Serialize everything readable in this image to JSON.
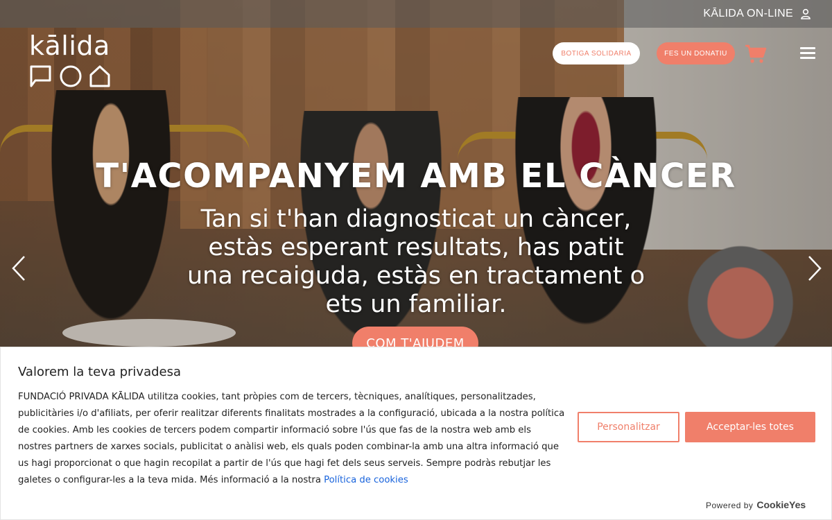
{
  "topbar": {
    "online_label": "KĀLIDA ON-LINE",
    "user_icon": "user-icon"
  },
  "logo": {
    "word": "kālida",
    "shapes": [
      "speech-bubble-icon",
      "circle-icon",
      "house-icon"
    ]
  },
  "header": {
    "shop_label": "BOTIGA SOLIDARIA",
    "donate_label": "FES UN DONATIU",
    "cart_icon": "cart-icon",
    "menu_icon": "hamburger-menu-icon"
  },
  "hero": {
    "title": "T'ACOMPANYEM AMB EL CÀNCER",
    "subtitle": "Tan si t'han diagnosticat un càncer, estàs esperant resultats, has patit una recaiguda, estàs en tractament o ets un familiar.",
    "cta_label": "COM T'AJUDEM",
    "prev_icon": "chevron-left-icon",
    "next_icon": "chevron-right-icon"
  },
  "cookie": {
    "title": "Valorem la teva privadesa",
    "text": "FUNDACIÓ PRIVADA KĀLIDA utilitza cookies, tant pròpies com de tercers, tècniques, analítiques, personalitzades, publicitàries i/o d'afiliats, per oferir realitzar diferents finalitats mostrades a la configuració, ubicada a la nostra política de cookies. Amb les cookies de tercers podem compartir informació sobre l'ús que fas de la nostra web amb els nostres partners de xarxes socials, publicitat o anàlisi web, els quals poden combinar-la amb una altra informació que us hagi proporcionat o que hagin recopilat a partir de l'ús que hagi fet dels seus serveis. Sempre podràs rebutjar les galetes o configurar-les a la teva mida. Més informació a la nostra",
    "link_label": "Política de cookies",
    "customize_label": "Personalitzar",
    "accept_label": "Acceptar-les totes",
    "powered_label": "Powered by",
    "powered_brand": "CookieYes"
  },
  "colors": {
    "accent": "#f07f6a",
    "link": "#1863dc",
    "text": "#212121"
  }
}
